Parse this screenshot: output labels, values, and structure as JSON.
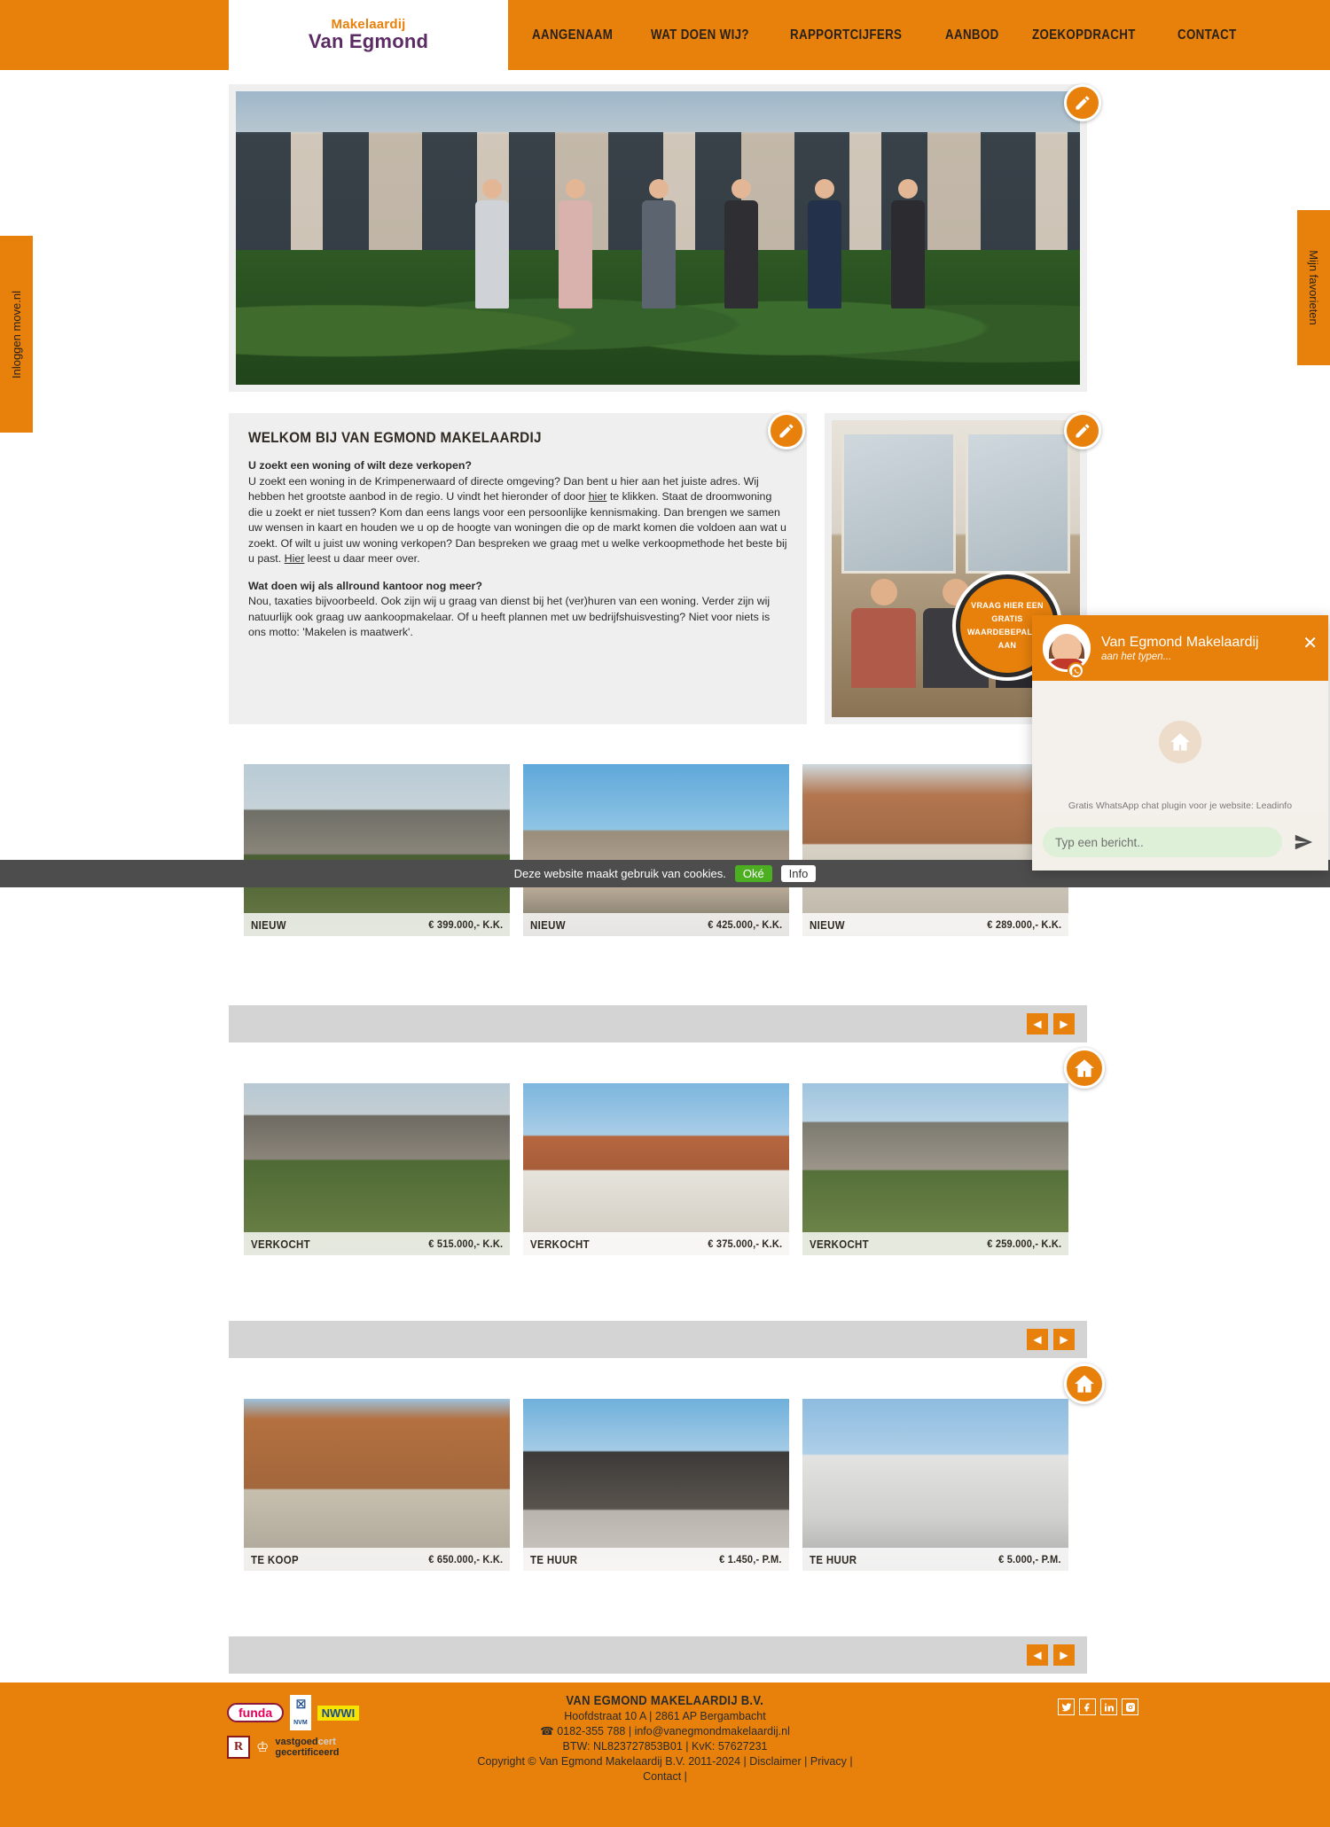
{
  "header": {
    "logo_top": "Makelaardij",
    "logo_bottom": "Van Egmond",
    "nav": [
      {
        "label": "AANGENAAM"
      },
      {
        "label": "WAT DOEN WIJ?"
      },
      {
        "label": "RAPPORTCIJFERS"
      },
      {
        "label": "AANBOD"
      },
      {
        "label": "ZOEKOPDRACHT"
      },
      {
        "label": "CONTACT"
      }
    ]
  },
  "side_tabs": {
    "left": "Inloggen move.nl",
    "right": "Mijn favorieten"
  },
  "welcome": {
    "title": "WELKOM BIJ VAN EGMOND MAKELAARDIJ",
    "sub1": "U zoekt een woning of wilt deze verkopen?",
    "p1a": "U zoekt een woning in de Krimpenerwaard of directe omgeving? Dan bent u hier aan het juiste adres. Wij hebben het grootste aanbod in de regio. U vindt het hieronder of door ",
    "link_hier": "hier",
    "p1b": " te klikken. Staat de droomwoning die u zoekt er niet tussen? Kom dan eens langs voor een persoonlijke kennismaking. Dan brengen we samen uw wensen in kaart en houden we u op de hoogte van woningen die op de markt komen die voldoen aan wat u zoekt. Of wilt u juist uw woning verkopen? Dan bespreken we graag met u welke verkoopmethode het beste bij u past. ",
    "link_hier2": "Hier",
    "p1c": " leest u daar meer over.",
    "sub2": "Wat doen wij als allround kantoor nog meer?",
    "p2": "Nou, taxaties bijvoorbeeld. Ook zijn wij u graag van dienst bij het (ver)huren van een woning. Verder zijn wij natuurlijk ook graag uw aankoopmakelaar. Of u heeft plannen met uw bedrijfshuisvesting? Niet voor niets is ons motto: 'Makelen is maatwerk'."
  },
  "value_badge": {
    "l1": "VRAAG HIER EEN",
    "l2": "GRATIS",
    "l3": "WAARDEBEPALING",
    "l4": "AAN"
  },
  "listings": {
    "row1": [
      {
        "status": "NIEUW",
        "price": "€ 399.000,- K.K."
      },
      {
        "status": "NIEUW",
        "price": "€ 425.000,- K.K."
      },
      {
        "status": "NIEUW",
        "price": "€ 289.000,- K.K."
      }
    ],
    "row2": [
      {
        "status": "VERKOCHT",
        "price": "€ 515.000,- K.K."
      },
      {
        "status": "VERKOCHT",
        "price": "€ 375.000,- K.K."
      },
      {
        "status": "VERKOCHT",
        "price": "€ 259.000,- K.K."
      }
    ],
    "row3": [
      {
        "status": "TE KOOP",
        "price": "€ 650.000,- K.K."
      },
      {
        "status": "TE HUUR",
        "price": "€ 1.450,- P.M."
      },
      {
        "status": "TE HUUR",
        "price": "€ 5.000,- P.M."
      }
    ],
    "prev": "◀",
    "next": "▶"
  },
  "cookie": {
    "text": "Deze website maakt gebruik van cookies.",
    "ok": "Oké",
    "info": "Info"
  },
  "chat": {
    "name": "Van Egmond Makelaardij",
    "status": "aan het typen...",
    "close": "✕",
    "credit": "Gratis WhatsApp chat plugin voor je website: Leadinfo",
    "input_placeholder": "Typ een bericht..",
    "input_value": "Typ een bericht.."
  },
  "footer": {
    "badges": {
      "funda": "funda",
      "nvm_mark": "☒",
      "nvm_text": "NVM",
      "nwwi": "NWWI",
      "r": "R",
      "vastgoed1": "vastgoed",
      "vastgoed2": "cert",
      "vastgoed3": "gecertificeerd"
    },
    "company": "VAN EGMOND MAKELAARDIJ B.V.",
    "address": "Hoofdstraat 10 A | 2861 AP Bergambacht",
    "phone": "0182-355 788",
    "email": "info@vanegmondmakelaardij.nl",
    "btw": "BTW: NL823727853B01 | KvK: 57627231",
    "copyright": "Copyright © Van Egmond Makelaardij B.V. 2011-2024 |",
    "disclaimer": "Disclaimer",
    "privacy": "Privacy",
    "contact": "Contact |",
    "social": [
      "twitter",
      "facebook",
      "linkedin",
      "instagram"
    ]
  },
  "colors": {
    "brand_orange": "#E8810C",
    "purple": "#5B2B63",
    "panel_gray": "#efefef",
    "strip_gray": "#d4d4d4",
    "cookie_bg": "#4d4d4d",
    "ok_green": "#4CAF22"
  }
}
